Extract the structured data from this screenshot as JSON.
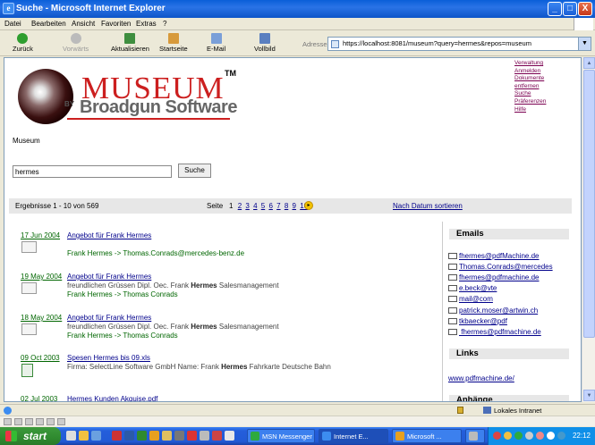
{
  "window": {
    "title": "Suche - Microsoft Internet Explorer",
    "icon": "ie-icon",
    "controls": [
      "_",
      "□",
      "X"
    ]
  },
  "menu": [
    "Datei",
    "Bearbeiten",
    "Ansicht",
    "Favoriten",
    "Extras",
    "?"
  ],
  "toolbar": {
    "back": "Zurück",
    "forward": "Vorwärts",
    "refresh": "Aktualisieren",
    "home": "Startseite",
    "email": "E-Mail",
    "fullscreen": "Vollbild",
    "address_label": "Adresse",
    "address": "https://localhost:8081/museum?query=hermes&repos=museum"
  },
  "logo": {
    "main": "MUSEUM",
    "tm": "TM",
    "by": "BY",
    "sub": "Broadgun Software"
  },
  "top_links": [
    "Verwaltung",
    "Anmelden",
    "Dokumente",
    "entfernen",
    "Suche",
    "Präferenzen",
    "Hilfe"
  ],
  "breadcrumb": "Museum",
  "search": {
    "value": "hermes",
    "button": "Suche"
  },
  "results_bar": {
    "count": "Ergebnisse 1 - 10 von 569",
    "seite_label": "Seite",
    "pages": [
      "1",
      "2",
      "3",
      "4",
      "5",
      "6",
      "7",
      "8",
      "9",
      "10"
    ],
    "sort_link": "Nach Datum sortieren"
  },
  "results": [
    {
      "date": "17 Jun 2004",
      "title": "Angebot für Frank Hermes",
      "snippet": "",
      "route": "Frank Hermes -> Thomas.Conrads@mercedes-benz.de",
      "icon": "email-doc-icon"
    },
    {
      "date": "19 May 2004",
      "title": "Angebot für Frank Hermes",
      "snippet_pre": "freundlichen Grüssen Dipl. Oec. Frank ",
      "snippet_bold": "Hermes",
      "snippet_post": " Salesmanagement",
      "route": "Frank Hermes -> Thomas Conrads",
      "icon": "email-doc-icon"
    },
    {
      "date": "18 May 2004",
      "title": "Angebot für Frank Hermes",
      "snippet_pre": "freundlichen Grüssen Dipl. Oec. Frank ",
      "snippet_bold": "Hermes",
      "snippet_post": " Salesmanagement",
      "route": "Frank Hermes -> Thomas Conrads",
      "icon": "email-doc-icon"
    },
    {
      "date": "09 Oct 2003",
      "title": "Spesen Hermes bis 09.xls",
      "snippet_pre": "Firma: SelectLine Software GmbH Name: Frank ",
      "snippet_bold": "Hermes",
      "snippet_post": " Fahrkarte Deutsche Bahn",
      "route": "",
      "icon": "excel-file-icon"
    },
    {
      "date": "02 Jul 2003",
      "title": "Hermes Kunden Akquise.pdf",
      "snippet": "",
      "route": "",
      "icon": "pdf-file-icon"
    }
  ],
  "sidebar": {
    "emails_heading": "Emails",
    "emails": [
      "fhermes@pdfMachine.de",
      "Thomas.Conrads@mercedes",
      "fhermes@pdfmachine.de",
      "e.beck@vte",
      "mail@com",
      "patrick.moser@artwin.ch",
      "tkbaecker@pdf",
      " fhermes@pdfmachine.de"
    ],
    "links_heading": "Links",
    "links": [
      "www.pdfmachine.de/"
    ],
    "attachments_heading": "Anhänge"
  },
  "status": {
    "zone": "Lokales Intranet"
  },
  "taskbar": {
    "start": "start",
    "tasks": [
      "MSN Messenger",
      "Internet E...",
      "Microsoft ...",
      ""
    ],
    "clock": "22:12"
  }
}
